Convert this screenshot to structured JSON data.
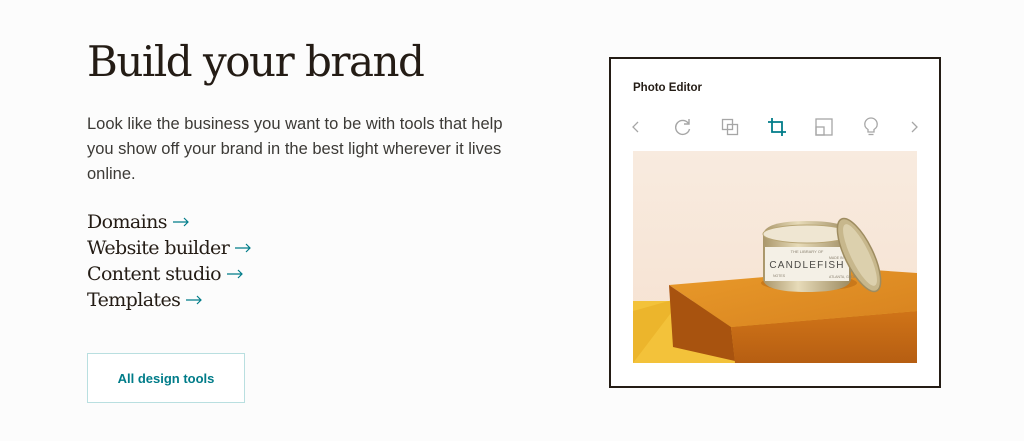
{
  "hero": {
    "headline": "Build your brand",
    "description": "Look like the business you want to be with tools that help you show off your brand in the best light wherever it lives online."
  },
  "links": [
    {
      "label": "Domains"
    },
    {
      "label": "Website builder"
    },
    {
      "label": "Content studio"
    },
    {
      "label": "Templates"
    }
  ],
  "cta": {
    "label": "All design tools"
  },
  "photo_editor": {
    "title": "Photo Editor",
    "tools": [
      "chevron-left-icon",
      "rotate-icon",
      "layers-icon",
      "crop-icon",
      "resize-icon",
      "lightbulb-icon",
      "chevron-right-icon"
    ],
    "active_tool": "crop-icon",
    "image": {
      "lid_brand": "CANDLEFISH",
      "small_top": "THE LIBRARY OF",
      "small_left": "NOTES",
      "small_right": "MADE IN",
      "small_bottom": "ATLANTA, GEORGIA"
    }
  },
  "colors": {
    "accent": "#007c89",
    "text": "#241c15",
    "border": "#241c15",
    "button_border": "#b9dfe0",
    "tool_gray": "#a6a6a6"
  }
}
